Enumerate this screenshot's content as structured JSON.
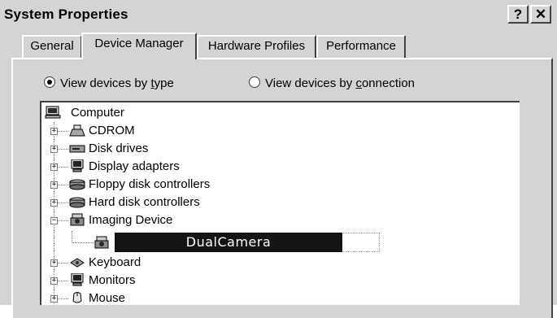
{
  "window": {
    "title": "System Properties",
    "help_button": "?",
    "close_button": "✕"
  },
  "tabs": [
    {
      "label": "General",
      "active": false
    },
    {
      "label": "Device Manager",
      "active": true
    },
    {
      "label": "Hardware Profiles",
      "active": false
    },
    {
      "label": "Performance",
      "active": false
    }
  ],
  "view_options": {
    "by_type_prefix": "View devices by ",
    "by_type_access": "t",
    "by_type_suffix": "ype",
    "by_connection_prefix": "View devices by ",
    "by_connection_access": "c",
    "by_connection_suffix": "onnection",
    "selected": "by_type"
  },
  "tree": {
    "root": {
      "label": "Computer",
      "icon": "computer-icon"
    },
    "items": [
      {
        "label": "CDROM",
        "icon": "cdrom-icon",
        "expander": "+"
      },
      {
        "label": "Disk drives",
        "icon": "disk-drive-icon",
        "expander": "+"
      },
      {
        "label": "Display adapters",
        "icon": "monitor-icon",
        "expander": "+"
      },
      {
        "label": "Floppy disk controllers",
        "icon": "controller-icon",
        "expander": "+"
      },
      {
        "label": "Hard disk controllers",
        "icon": "controller-icon",
        "expander": "+"
      },
      {
        "label": "Imaging Device",
        "icon": "imaging-device-icon",
        "expander": "−"
      },
      {
        "label": "Keyboard",
        "icon": "keyboard-icon",
        "expander": "+"
      },
      {
        "label": "Monitors",
        "icon": "monitor-icon",
        "expander": "+"
      },
      {
        "label": "Mouse",
        "icon": "mouse-icon",
        "expander": "+"
      }
    ],
    "child": {
      "label": "DualCamera",
      "icon": "camera-icon",
      "parent": "Imaging Device",
      "selected": true
    }
  },
  "colors": {
    "window_face": "#d4d4d4",
    "highlight": "#ffffff",
    "shadow": "#404040",
    "selection": "#141414",
    "selection_text": "#ffffff"
  }
}
